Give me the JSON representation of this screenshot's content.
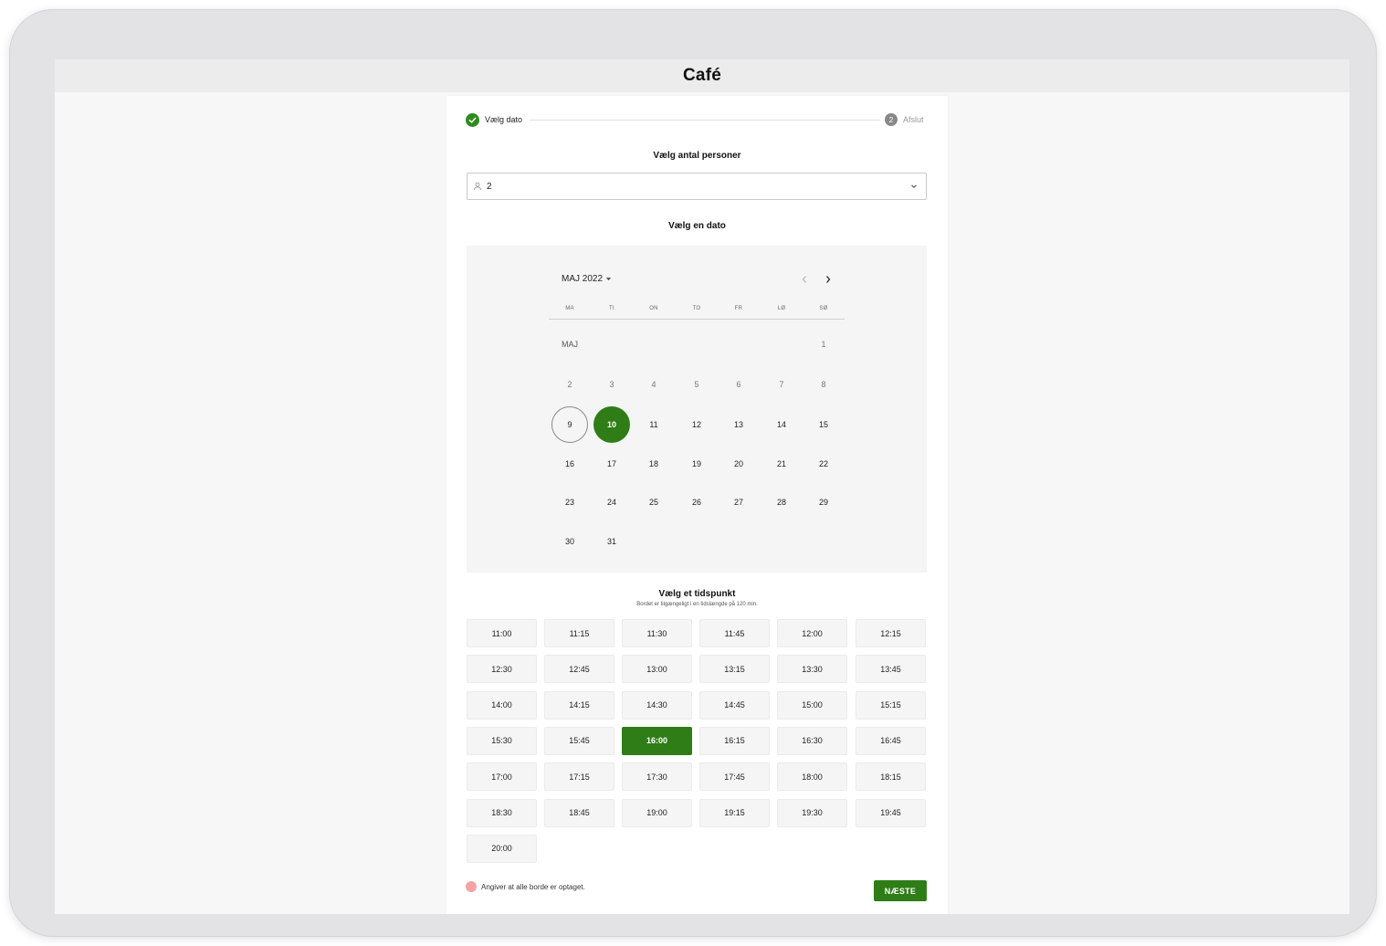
{
  "app": {
    "title": "Café"
  },
  "stepper": {
    "step1": {
      "label": "Vælg dato",
      "status": "done"
    },
    "step2": {
      "number": "2",
      "label": "Afslut"
    }
  },
  "persons": {
    "title": "Vælg antal personer",
    "value": "2"
  },
  "calendar": {
    "title": "Vælg en dato",
    "month_year": "MAJ 2022",
    "month_label": "MAJ",
    "weekdays": [
      "MA",
      "TI",
      "ON",
      "TO",
      "FR",
      "LØ",
      "SØ"
    ],
    "weeks": [
      [
        "",
        "",
        "",
        "",
        "",
        "",
        "1"
      ],
      [
        "2",
        "3",
        "4",
        "5",
        "6",
        "7",
        "8"
      ],
      [
        "9",
        "10",
        "11",
        "12",
        "13",
        "14",
        "15"
      ],
      [
        "16",
        "17",
        "18",
        "19",
        "20",
        "21",
        "22"
      ],
      [
        "23",
        "24",
        "25",
        "26",
        "27",
        "28",
        "29"
      ],
      [
        "30",
        "31",
        "",
        "",
        "",
        "",
        ""
      ]
    ],
    "today": "9",
    "selected": "10",
    "accent_color": "#2e7d16"
  },
  "times": {
    "title": "Vælg et tidspunkt",
    "subtitle": "Bordet er tilgængeligt i en tidslængde på 120 min.",
    "slots": [
      "11:00",
      "11:15",
      "11:30",
      "11:45",
      "12:00",
      "12:15",
      "12:30",
      "12:45",
      "13:00",
      "13:15",
      "13:30",
      "13:45",
      "14:00",
      "14:15",
      "14:30",
      "14:45",
      "15:00",
      "15:15",
      "15:30",
      "15:45",
      "16:00",
      "16:15",
      "16:30",
      "16:45",
      "17:00",
      "17:15",
      "17:30",
      "17:45",
      "18:00",
      "18:15",
      "18:30",
      "18:45",
      "19:00",
      "19:15",
      "19:30",
      "19:45",
      "20:00"
    ],
    "selected": "16:00"
  },
  "legend": {
    "text": "Angiver at alle borde er optaget.",
    "color": "#f5a3a3"
  },
  "actions": {
    "next_label": "NÆSTE"
  }
}
